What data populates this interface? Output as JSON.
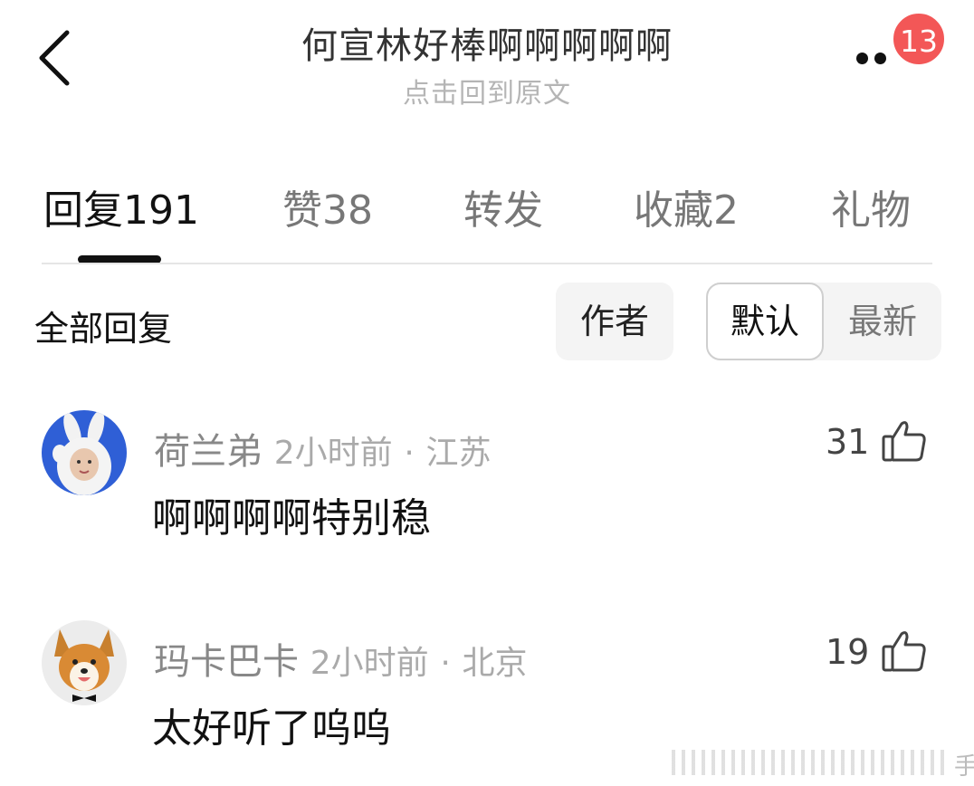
{
  "header": {
    "back_icon": "chevron-left-icon",
    "title": "何宣林好棒啊啊啊啊啊",
    "subtitle": "点击回到原文",
    "more_icon": "more-dots-icon",
    "notification_count": "13",
    "badge_color": "#f35757"
  },
  "tabs": [
    {
      "label": "回复",
      "count": "191",
      "active": true
    },
    {
      "label": "赞",
      "count": "38",
      "active": false
    },
    {
      "label": "转发",
      "count": "",
      "active": false
    },
    {
      "label": "收藏",
      "count": "2",
      "active": false
    },
    {
      "label": "礼物",
      "count": "",
      "active": false
    }
  ],
  "filter": {
    "all_label": "全部回复",
    "author_label": "作者",
    "sort_options": [
      "默认",
      "最新"
    ],
    "selected_sort": "默认"
  },
  "comments": [
    {
      "username": "荷兰弟",
      "time": "2小时前",
      "separator": "·",
      "location": "江苏",
      "text": "啊啊啊啊特别稳",
      "likes": "31",
      "avatar": "rabbit-costume-avatar",
      "like_icon": "thumbs-up-icon"
    },
    {
      "username": "玛卡巴卡",
      "time": "2小时前",
      "separator": "·",
      "location": "北京",
      "text": "太好听了呜呜",
      "likes": "19",
      "avatar": "corgi-dog-avatar",
      "like_icon": "thumbs-up-icon"
    }
  ],
  "watermark": {
    "visible_char": "手"
  }
}
